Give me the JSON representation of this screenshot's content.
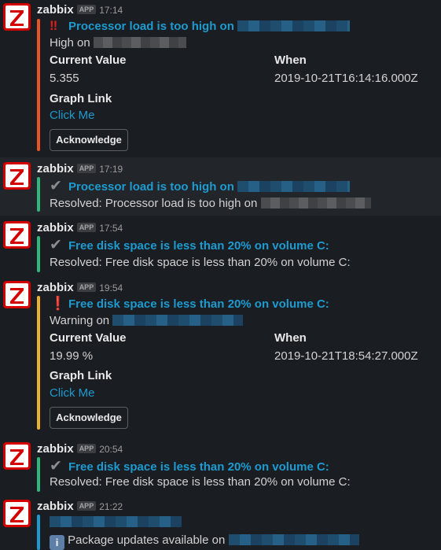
{
  "colors": {
    "avatar": "#d40000",
    "problem": "#e8542a",
    "resolved": "#2eb67d",
    "warning": "#ecb22e",
    "info": "#1d9bd1",
    "link": "#1d9bd1"
  },
  "messages": [
    {
      "sender": "zabbix",
      "badge": "APP",
      "time": "17:14",
      "status_icon": "double-exclamation-icon",
      "title": "Processor load is too high on",
      "line": "High on",
      "current_value_label": "Current Value",
      "current_value": "5.355",
      "when_label": "When",
      "when": "2019-10-21T16:14:16.000Z",
      "graph_link_label": "Graph Link",
      "graph_link_text": "Click Me",
      "button": "Acknowledge"
    },
    {
      "sender": "zabbix",
      "badge": "APP",
      "time": "17:19",
      "status_icon": "check-icon",
      "title": "Processor load is too high on",
      "line": "Resolved: Processor load is too high on"
    },
    {
      "sender": "zabbix",
      "badge": "APP",
      "time": "17:54",
      "status_icon": "check-icon",
      "title": "Free disk space is less than 20% on volume C:",
      "line": "Resolved: Free disk space is less than 20% on volume C:"
    },
    {
      "sender": "zabbix",
      "badge": "APP",
      "time": "19:54",
      "status_icon": "exclamation-icon",
      "title": "Free disk space is less than 20% on volume C:",
      "line": "Warning on",
      "current_value_label": "Current Value",
      "current_value": "19.99 %",
      "when_label": "When",
      "when": "2019-10-21T18:54:27.000Z",
      "graph_link_label": "Graph Link",
      "graph_link_text": "Click Me",
      "button": "Acknowledge"
    },
    {
      "sender": "zabbix",
      "badge": "APP",
      "time": "20:54",
      "status_icon": "check-icon",
      "title": "Free disk space is less than 20% on volume C:",
      "line": "Resolved: Free disk space is less than 20% on volume C:"
    },
    {
      "sender": "zabbix",
      "badge": "APP",
      "time": "21:22",
      "status_icon": "info-icon",
      "line": "Package updates available on"
    }
  ]
}
